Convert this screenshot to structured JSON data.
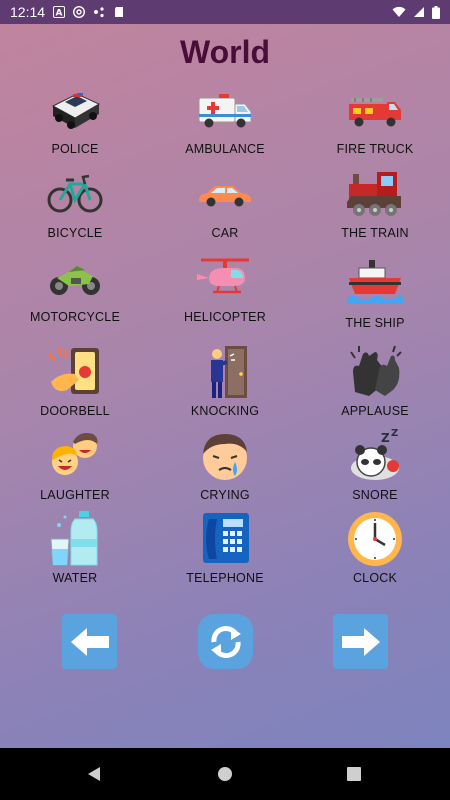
{
  "status_bar": {
    "time": "12:14"
  },
  "screen_title": "World",
  "tiles": [
    {
      "label": "POLICE",
      "icon": "police-car-icon"
    },
    {
      "label": "AMBULANCE",
      "icon": "ambulance-icon"
    },
    {
      "label": "FIRE TRUCK",
      "icon": "fire-truck-icon"
    },
    {
      "label": "BICYCLE",
      "icon": "bicycle-icon"
    },
    {
      "label": "CAR",
      "icon": "car-icon"
    },
    {
      "label": "THE TRAIN",
      "icon": "train-icon"
    },
    {
      "label": "MOTORCYCLE",
      "icon": "motorcycle-icon"
    },
    {
      "label": "HELICOPTER",
      "icon": "helicopter-icon"
    },
    {
      "label": "THE SHIP",
      "icon": "ship-icon"
    },
    {
      "label": "DOORBELL",
      "icon": "doorbell-icon"
    },
    {
      "label": "KNOCKING",
      "icon": "knocking-door-icon"
    },
    {
      "label": "APPLAUSE",
      "icon": "clapping-hands-icon"
    },
    {
      "label": "LAUGHTER",
      "icon": "laughing-faces-icon"
    },
    {
      "label": "CRYING",
      "icon": "crying-face-icon"
    },
    {
      "label": "SNORE",
      "icon": "sleeping-panda-icon"
    },
    {
      "label": "WATER",
      "icon": "water-bottle-icon"
    },
    {
      "label": "TELEPHONE",
      "icon": "telephone-icon"
    },
    {
      "label": "CLOCK",
      "icon": "clock-icon"
    }
  ],
  "controls": {
    "prev_icon": "arrow-left-icon",
    "refresh_icon": "refresh-icon",
    "next_icon": "arrow-right-icon"
  },
  "colors": {
    "status_bar": "#5e3b71",
    "title": "#4a0d37",
    "button": "#5aa3de"
  }
}
